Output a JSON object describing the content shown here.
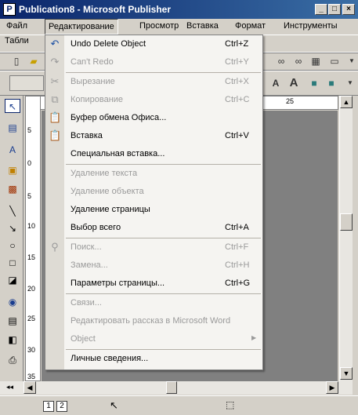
{
  "window": {
    "title": "Publication8 - Microsoft Publisher",
    "app_icon": "publisher-icon",
    "min_glyph": "_",
    "max_glyph": "□",
    "close_glyph": "×"
  },
  "menubar": {
    "items": [
      "Файл",
      "Редактирование",
      "Просмотр",
      "Вставка",
      "Формат",
      "Инструменты",
      "Табли"
    ]
  },
  "rulers": {
    "v_ticks": [
      "5",
      "0",
      "5",
      "10",
      "15",
      "20",
      "25",
      "30",
      "35"
    ],
    "h_tick": "25"
  },
  "status": {
    "pages": [
      "1",
      "2"
    ]
  },
  "edit_menu": {
    "items": [
      {
        "label": "Undo Delete Object",
        "shortcut": "Ctrl+Z",
        "icon": "undo-icon",
        "enabled": true
      },
      {
        "label": "Can't Redo",
        "shortcut": "Ctrl+Y",
        "icon": "redo-icon",
        "enabled": false
      },
      {
        "label": "Вырезание",
        "shortcut": "Ctrl+X",
        "icon": "cut-icon",
        "enabled": false
      },
      {
        "label": "Копирование",
        "shortcut": "Ctrl+C",
        "icon": "copy-icon",
        "enabled": false
      },
      {
        "label": "Буфер обмена Офиса...",
        "shortcut": "",
        "icon": "clipboard-icon",
        "enabled": true
      },
      {
        "label": "Вставка",
        "shortcut": "Ctrl+V",
        "icon": "paste-icon",
        "enabled": true
      },
      {
        "label": "Специальная вставка...",
        "shortcut": "",
        "icon": "",
        "enabled": true
      },
      {
        "label": "Удаление текста",
        "shortcut": "",
        "icon": "",
        "enabled": false
      },
      {
        "label": "Удаление объекта",
        "shortcut": "",
        "icon": "",
        "enabled": false
      },
      {
        "label": "Удаление страницы",
        "shortcut": "",
        "icon": "",
        "enabled": true
      },
      {
        "label": "Выбор всего",
        "shortcut": "Ctrl+A",
        "icon": "",
        "enabled": true
      },
      {
        "label": "Поиск...",
        "shortcut": "Ctrl+F",
        "icon": "find-icon",
        "enabled": false
      },
      {
        "label": "Замена...",
        "shortcut": "Ctrl+H",
        "icon": "",
        "enabled": false
      },
      {
        "label": "Параметры страницы...",
        "shortcut": "Ctrl+G",
        "icon": "",
        "enabled": true
      },
      {
        "label": "Связи...",
        "shortcut": "",
        "icon": "",
        "enabled": false
      },
      {
        "label": "Редактировать рассказ в Microsoft Word",
        "shortcut": "",
        "icon": "",
        "enabled": false
      },
      {
        "label": "Object",
        "shortcut": "",
        "icon": "",
        "enabled": false
      },
      {
        "label": "Личные сведения...",
        "shortcut": "",
        "icon": "",
        "enabled": true
      }
    ]
  }
}
